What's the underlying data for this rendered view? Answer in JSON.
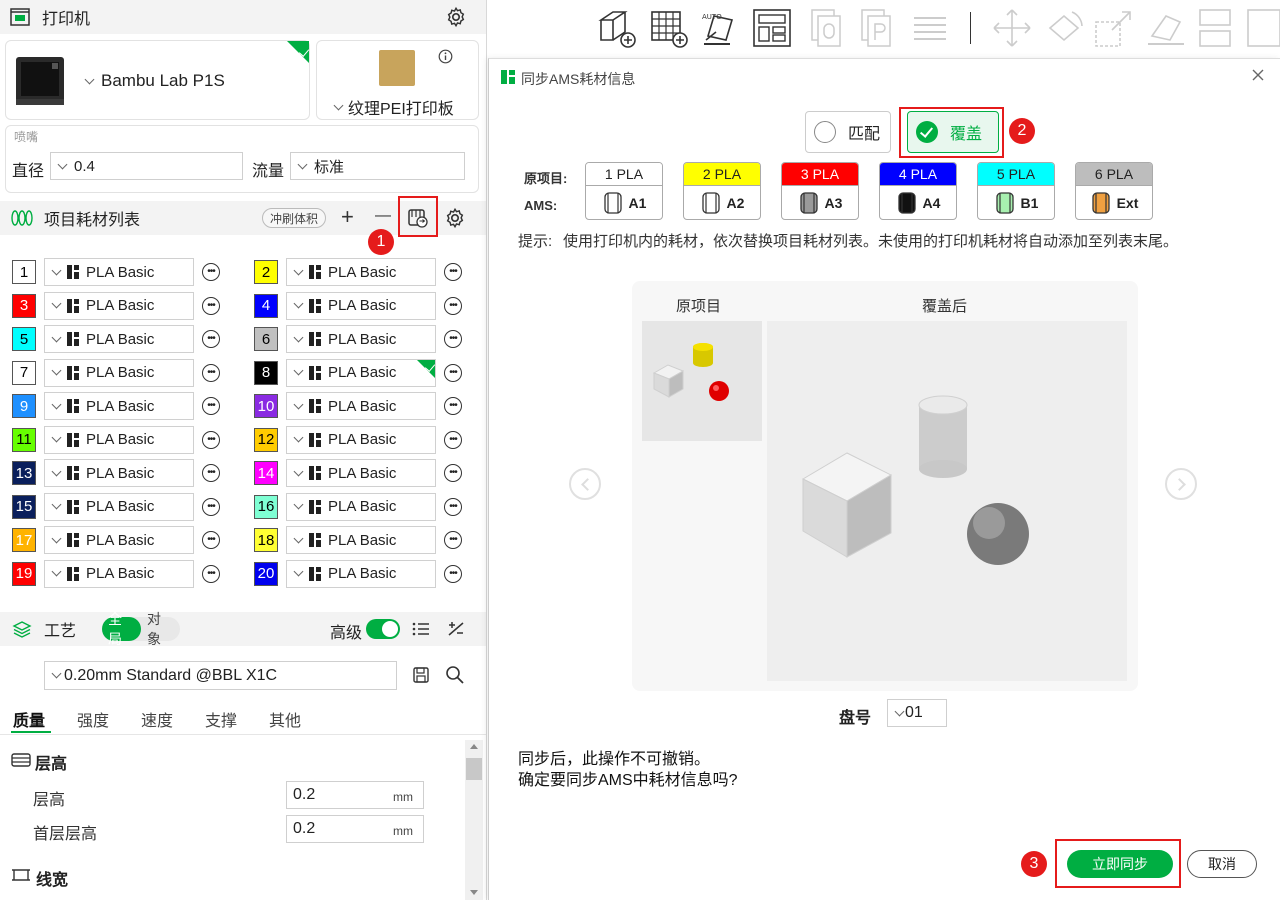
{
  "printer": {
    "section_title": "打印机",
    "printer_name": "Bambu Lab P1S",
    "plate_name": "纹理PEI打印板",
    "nozzle_section": "喷嘴",
    "diameter_label": "直径",
    "diameter_value": "0.4",
    "flow_label": "流量",
    "flow_value": "标准"
  },
  "filaments": {
    "section_title": "项目耗材列表",
    "flush_label": "冲刷体积",
    "add": "+",
    "remove": "—",
    "items": [
      {
        "num": "1",
        "color": "#ffffff",
        "text": "#000000",
        "name": "PLA Basic"
      },
      {
        "num": "2",
        "color": "#ffff00",
        "text": "#000000",
        "name": "PLA Basic"
      },
      {
        "num": "3",
        "color": "#ff0000",
        "text": "#ffffff",
        "name": "PLA Basic"
      },
      {
        "num": "4",
        "color": "#0000ff",
        "text": "#ffffff",
        "name": "PLA Basic"
      },
      {
        "num": "5",
        "color": "#00ffff",
        "text": "#000000",
        "name": "PLA Basic"
      },
      {
        "num": "6",
        "color": "#c0c0c0",
        "text": "#000000",
        "name": "PLA Basic"
      },
      {
        "num": "7",
        "color": "#ffffff",
        "text": "#000000",
        "name": "PLA Basic"
      },
      {
        "num": "8",
        "color": "#000000",
        "text": "#ffffff",
        "name": "PLA Basic"
      },
      {
        "num": "9",
        "color": "#1e90ff",
        "text": "#ffffff",
        "name": "PLA Basic"
      },
      {
        "num": "10",
        "color": "#8a2be2",
        "text": "#ffffff",
        "name": "PLA Basic"
      },
      {
        "num": "11",
        "color": "#66ff00",
        "text": "#000000",
        "name": "PLA Basic"
      },
      {
        "num": "12",
        "color": "#ffcc00",
        "text": "#000000",
        "name": "PLA Basic"
      },
      {
        "num": "13",
        "color": "#0a1f5c",
        "text": "#ffffff",
        "name": "PLA Basic"
      },
      {
        "num": "14",
        "color": "#ff00ff",
        "text": "#ffffff",
        "name": "PLA Basic"
      },
      {
        "num": "15",
        "color": "#0a1f5c",
        "text": "#ffffff",
        "name": "PLA Basic"
      },
      {
        "num": "16",
        "color": "#7fffd4",
        "text": "#000000",
        "name": "PLA Basic"
      },
      {
        "num": "17",
        "color": "#ffb300",
        "text": "#ffffff",
        "name": "PLA Basic"
      },
      {
        "num": "18",
        "color": "#ffff33",
        "text": "#000000",
        "name": "PLA Basic"
      },
      {
        "num": "19",
        "color": "#ff0000",
        "text": "#ffffff",
        "name": "PLA Basic"
      },
      {
        "num": "20",
        "color": "#0000ee",
        "text": "#ffffff",
        "name": "PLA Basic"
      }
    ]
  },
  "process": {
    "section_title": "工艺",
    "global": "全局",
    "object": "对象",
    "advanced": "高级",
    "preset": "0.20mm Standard @BBL X1C",
    "tabs": [
      "质量",
      "强度",
      "速度",
      "支撑",
      "其他"
    ],
    "layer_group": "层高",
    "layer_height_label": "层高",
    "layer_height_value": "0.2",
    "first_layer_label": "首层层高",
    "first_layer_value": "0.2",
    "unit": "mm",
    "line_width_group": "线宽"
  },
  "toolbar": {
    "auto_label": "AUTO"
  },
  "dialog": {
    "title": "同步AMS耗材信息",
    "mode_match": "匹配",
    "mode_override": "覆盖",
    "row_original": "原项目:",
    "row_ams": "AMS:",
    "slots": [
      {
        "top": "1 PLA",
        "top_bg": "#ffffff",
        "top_fg": "#222222",
        "ams": "A1",
        "spool": "#ffffff"
      },
      {
        "top": "2 PLA",
        "top_bg": "#ffff00",
        "top_fg": "#222222",
        "ams": "A2",
        "spool": "#ffffff"
      },
      {
        "top": "3 PLA",
        "top_bg": "#ff0000",
        "top_fg": "#ffffff",
        "ams": "A3",
        "spool": "#9a9a9a"
      },
      {
        "top": "4 PLA",
        "top_bg": "#0000ff",
        "top_fg": "#ffffff",
        "ams": "A4",
        "spool": "#111111"
      },
      {
        "top": "5 PLA",
        "top_bg": "#00ffff",
        "top_fg": "#222222",
        "ams": "B1",
        "spool": "#a8f0b0"
      },
      {
        "top": "6 PLA",
        "top_bg": "#bdbdbd",
        "top_fg": "#222222",
        "ams": "Ext",
        "spool": "#f0a040"
      }
    ],
    "hint_label": "提示:",
    "hint_text": "使用打印机内的耗材，依次替换项目耗材列表。未使用的打印机耗材将自动添加至列表末尾。",
    "preview_original": "原项目",
    "preview_after": "覆盖后",
    "plate_label": "盘号",
    "plate_value": "01",
    "confirm_line1": "同步后，此操作不可撤销。",
    "confirm_line2": "确定要同步AMS中耗材信息吗?",
    "sync_button": "立即同步",
    "cancel_button": "取消"
  },
  "annotations": {
    "step1": "1",
    "step2": "2",
    "step3": "3"
  },
  "colors": {
    "accent": "#00ae42",
    "annotation": "#e51b1b"
  }
}
